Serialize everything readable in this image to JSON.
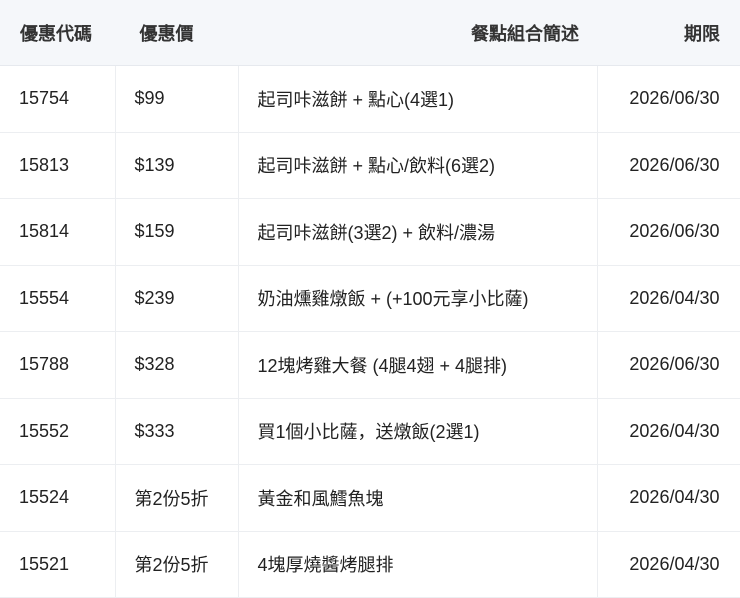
{
  "headers": [
    "優惠代碼",
    "優惠價",
    "餐點組合簡述",
    "期限"
  ],
  "rows": [
    {
      "code": "15754",
      "price": "$99",
      "desc": "起司咔滋餅 + 點心(4選1)",
      "expiry": "2026/06/30"
    },
    {
      "code": "15813",
      "price": "$139",
      "desc": "起司咔滋餅 + 點心/飲料(6選2)",
      "expiry": "2026/06/30"
    },
    {
      "code": "15814",
      "price": "$159",
      "desc": "起司咔滋餅(3選2) + 飲料/濃湯",
      "expiry": "2026/06/30"
    },
    {
      "code": "15554",
      "price": "$239",
      "desc": "奶油燻雞燉飯 + (+100元享小比薩)",
      "expiry": "2026/04/30"
    },
    {
      "code": "15788",
      "price": "$328",
      "desc": "12塊烤雞大餐 (4腿4翅 + 4腿排)",
      "expiry": "2026/06/30"
    },
    {
      "code": "15552",
      "price": "$333",
      "desc": "買1個小比薩，送燉飯(2選1)",
      "expiry": "2026/04/30"
    },
    {
      "code": "15524",
      "price": "第2份5折",
      "desc": "黃金和風鱈魚塊",
      "expiry": "2026/04/30"
    },
    {
      "code": "15521",
      "price": "第2份5折",
      "desc": "4塊厚燒醬烤腿排",
      "expiry": "2026/04/30"
    }
  ]
}
